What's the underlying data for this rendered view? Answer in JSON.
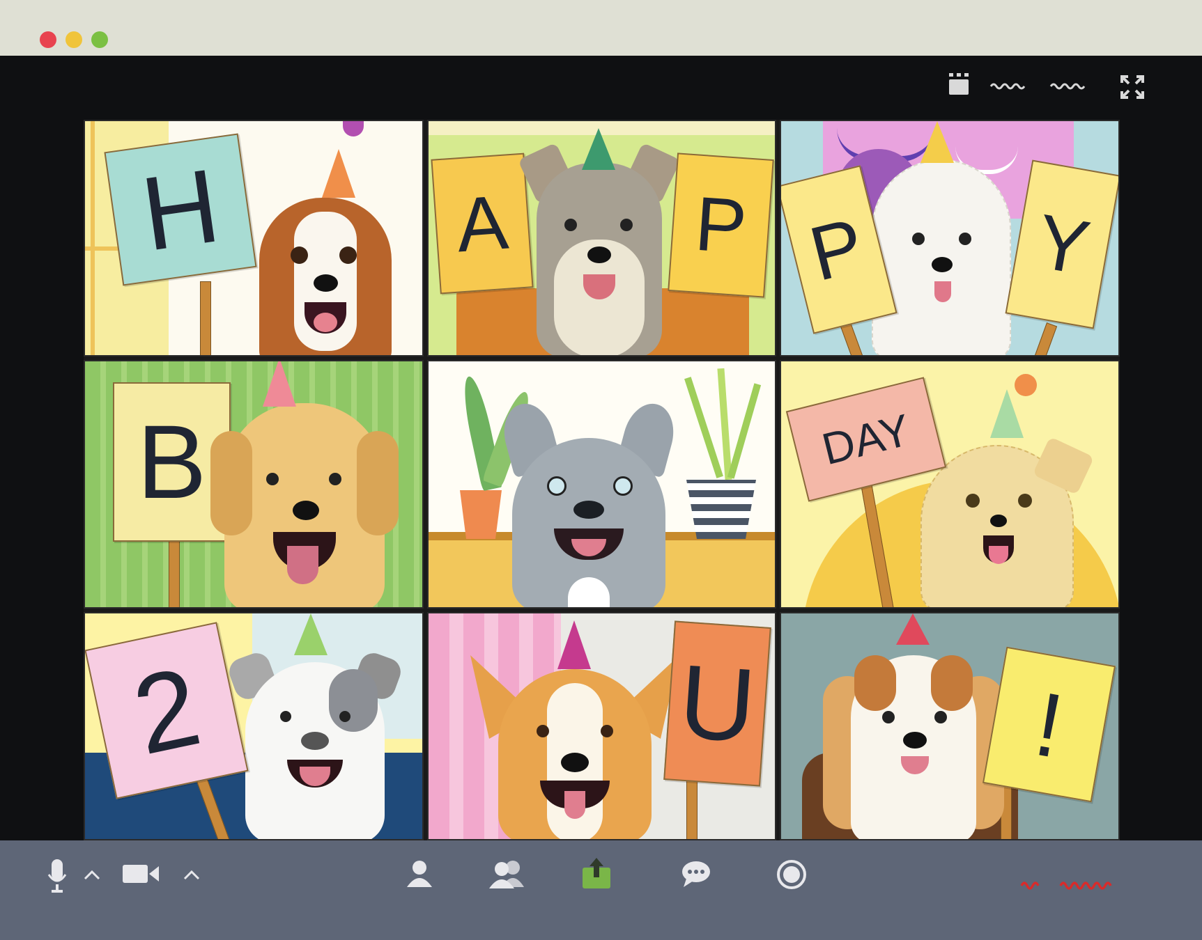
{
  "window": {
    "controls": [
      "close",
      "minimize",
      "zoom"
    ],
    "colors": {
      "close": "#e8434f",
      "minimize": "#f0c43a",
      "zoom": "#7bc043"
    }
  },
  "top_controls": {
    "icons": [
      "gallery-view-icon",
      "fullscreen-icon"
    ]
  },
  "gallery": {
    "tiles": [
      {
        "sign_left": "H",
        "sign_right": ""
      },
      {
        "sign_left": "A",
        "sign_right": "P"
      },
      {
        "sign_left": "P",
        "sign_right": "Y"
      },
      {
        "sign_left": "B",
        "sign_right": ""
      },
      {
        "sign_left": "",
        "sign_right": ""
      },
      {
        "sign_left": "",
        "sign_right": "DAY"
      },
      {
        "sign_left": "2",
        "sign_right": ""
      },
      {
        "sign_left": "",
        "sign_right": "U"
      },
      {
        "sign_left": "",
        "sign_right": "!"
      }
    ]
  },
  "toolbar": {
    "icons": [
      "microphone-icon",
      "camera-icon",
      "participant-icon",
      "participants-icon",
      "share-screen-icon",
      "chat-icon",
      "record-icon"
    ],
    "share_color": "#7ab648",
    "record_color": "#d92b2b"
  }
}
